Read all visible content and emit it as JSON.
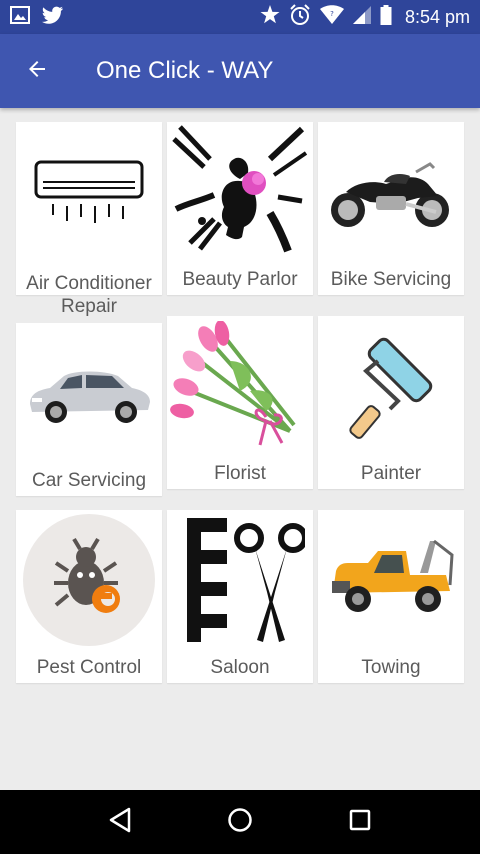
{
  "status_bar": {
    "time": "8:54 pm",
    "icons": [
      "image-icon",
      "twitter-icon",
      "star-icon",
      "alarm-icon",
      "wifi-icon",
      "signal-icon",
      "battery-icon"
    ]
  },
  "app_bar": {
    "title": "One Click - WAY",
    "back_icon": "arrow-left-icon"
  },
  "services": [
    {
      "label": "Air Conditioner Repair",
      "icon": "air-conditioner-icon"
    },
    {
      "label": "Beauty Parlor",
      "icon": "beauty-parlor-icon"
    },
    {
      "label": "Bike Servicing",
      "icon": "motorbike-icon"
    },
    {
      "label": "Car Servicing",
      "icon": "car-icon"
    },
    {
      "label": "Florist",
      "icon": "flowers-icon"
    },
    {
      "label": "Painter",
      "icon": "paint-roller-icon"
    },
    {
      "label": "Pest Control",
      "icon": "bug-icon"
    },
    {
      "label": "Saloon",
      "icon": "comb-scissors-icon"
    },
    {
      "label": "Towing",
      "icon": "tow-truck-icon"
    }
  ],
  "nav_bar": {
    "buttons": [
      "back-triangle-icon",
      "home-circle-icon",
      "recents-square-icon"
    ]
  },
  "colors": {
    "status_bar": "#2f459a",
    "app_bar": "#3f56b0",
    "background": "#ececec",
    "tile": "#ffffff",
    "label_text": "#5b5b5b"
  }
}
